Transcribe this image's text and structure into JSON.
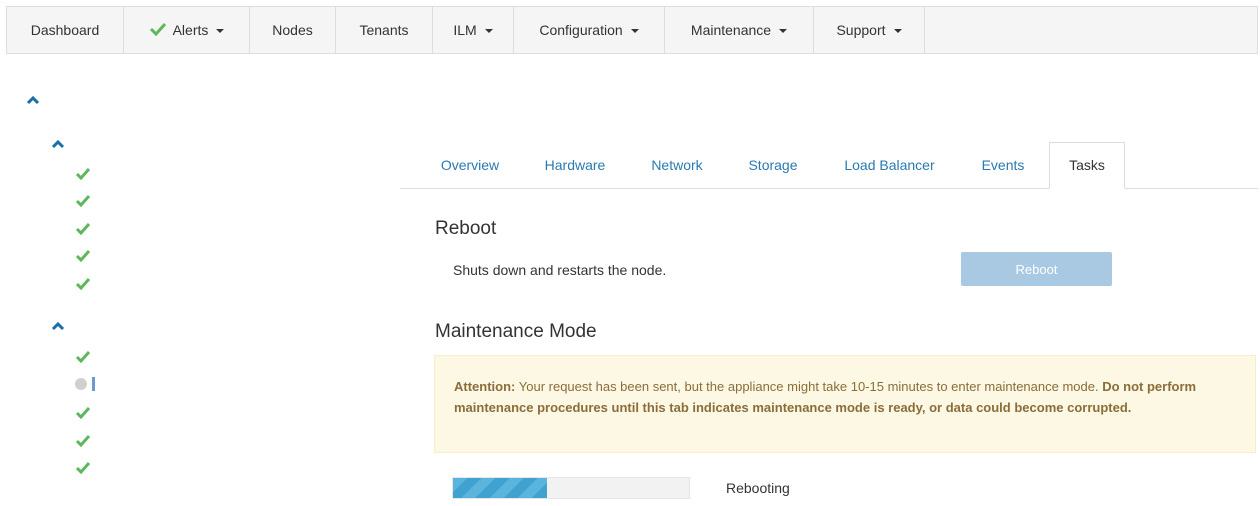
{
  "nav": {
    "items": [
      {
        "label": "Dashboard",
        "dropdown": false,
        "icon": null
      },
      {
        "label": "Alerts",
        "dropdown": true,
        "icon": "check-icon"
      },
      {
        "label": "Nodes",
        "dropdown": false,
        "icon": null
      },
      {
        "label": "Tenants",
        "dropdown": false,
        "icon": null
      },
      {
        "label": "ILM",
        "dropdown": true,
        "icon": null
      },
      {
        "label": "Configuration",
        "dropdown": true,
        "icon": null
      },
      {
        "label": "Maintenance",
        "dropdown": true,
        "icon": null
      },
      {
        "label": "Support",
        "dropdown": true,
        "icon": null
      }
    ]
  },
  "tabs": [
    {
      "label": "Overview",
      "active": false
    },
    {
      "label": "Hardware",
      "active": false
    },
    {
      "label": "Network",
      "active": false
    },
    {
      "label": "Storage",
      "active": false
    },
    {
      "label": "Load Balancer",
      "active": false
    },
    {
      "label": "Events",
      "active": false
    },
    {
      "label": "Tasks",
      "active": true
    }
  ],
  "reboot": {
    "title": "Reboot",
    "description": "Shuts down and restarts the node.",
    "button_label": "Reboot",
    "button_disabled": true
  },
  "maintenance": {
    "title": "Maintenance Mode",
    "alert_strong": "Attention:",
    "alert_text": " Your request has been sent, but the appliance might take 10-15 minutes to enter maintenance mode.",
    "alert_bold": " Do not perform maintenance procedures until this tab indicates maintenance mode is ready, or data could become corrupted.",
    "progress_fraction": 0.4,
    "progress_label": "Rebooting"
  },
  "colors": {
    "link": "#2a7ab0",
    "success": "#5cb85c",
    "warning_bg": "#fcf8e3",
    "warning_text": "#8a6d3b",
    "progress": "#5bb4dc"
  }
}
